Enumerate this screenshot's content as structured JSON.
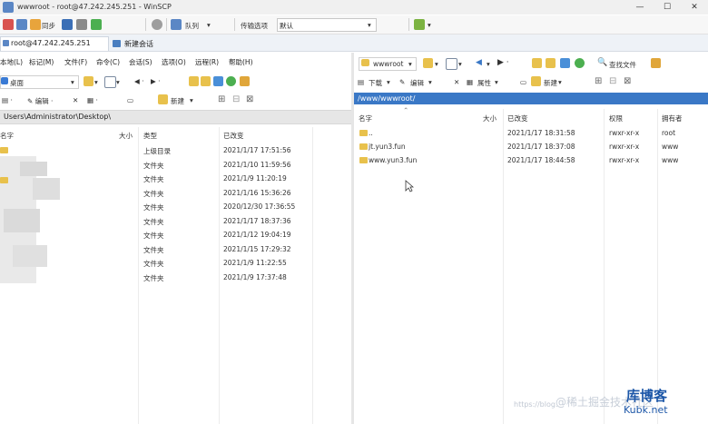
{
  "window": {
    "title": "wwwroot - root@47.242.245.251 - WinSCP",
    "minimize": "—",
    "maximize": "☐",
    "close": "✕"
  },
  "toolbar": {
    "sync_label": "同步",
    "queue_label": "队列",
    "transfer_label": "传输选项",
    "transfer_value": "默认"
  },
  "session": {
    "tab_label": "root@47.242.245.251",
    "new_session_label": "新建会话"
  },
  "menu": [
    "本地(L)",
    "标记(M)",
    "文件(F)",
    "命令(C)",
    "会话(S)",
    "选项(O)",
    "远程(R)",
    "帮助(H)"
  ],
  "left": {
    "drive": "桌面",
    "new_label": "新建",
    "path": "Users\\Administrator\\Desktop\\",
    "headers": {
      "name": "名字",
      "size": "大小",
      "type": "类型",
      "changed": "已改变"
    },
    "rows": [
      {
        "type": "上级目录",
        "changed": "2021/1/17  17:51:56"
      },
      {
        "type": "文件夹",
        "changed": "2021/1/10  11:59:56"
      },
      {
        "type": "文件夹",
        "changed": "2021/1/9  11:20:19"
      },
      {
        "type": "文件夹",
        "changed": "2021/1/16  15:36:26"
      },
      {
        "type": "文件夹",
        "changed": "2020/12/30  17:36:55"
      },
      {
        "type": "文件夹",
        "changed": "2021/1/17  18:37:36"
      },
      {
        "type": "文件夹",
        "changed": "2021/1/12  19:04:19"
      },
      {
        "type": "文件夹",
        "changed": "2021/1/15  17:29:32"
      },
      {
        "type": "文件夹",
        "changed": "2021/1/9  11:22:55"
      },
      {
        "type": "文件夹",
        "changed": "2021/1/9  17:37:48"
      }
    ]
  },
  "right": {
    "folder": "wwwroot",
    "find_label": "查找文件",
    "download_label": "下载",
    "edit_label": "编辑",
    "props_label": "属性",
    "new_label": "新建",
    "path": "/www/wwwroot/",
    "headers": {
      "name": "名字",
      "size": "大小",
      "changed": "已改变",
      "perm": "权限",
      "owner": "拥有者"
    },
    "rows": [
      {
        "name": "..",
        "changed": "2021/1/17 18:31:58",
        "perm": "rwxr-xr-x",
        "owner": "root"
      },
      {
        "name": "jt.yun3.fun",
        "changed": "2021/1/17 18:37:08",
        "perm": "rwxr-xr-x",
        "owner": "www"
      },
      {
        "name": "www.yun3.fun",
        "changed": "2021/1/17 18:44:58",
        "perm": "rwxr-xr-x",
        "owner": "www"
      }
    ]
  },
  "watermark": {
    "line1": "@稀土掘金技术社区",
    "brand": "库博客",
    "domain": "Kubk.net",
    "url": "https://blog."
  },
  "colors": {
    "path_bar": "#3a78c6",
    "folder": "#e8c14c",
    "brand": "#1d57a8"
  }
}
